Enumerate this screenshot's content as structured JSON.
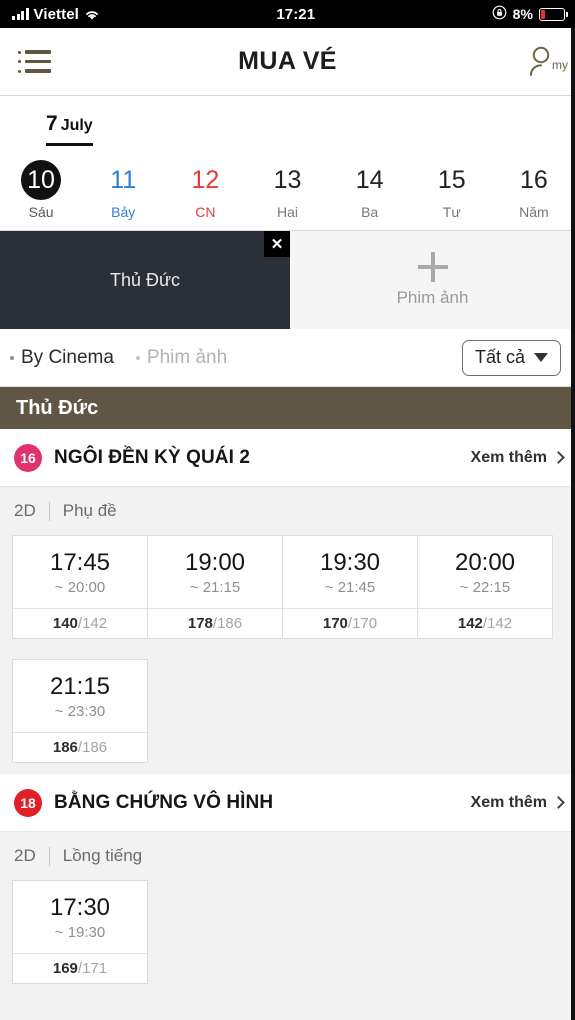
{
  "status_bar": {
    "carrier": "Viettel",
    "time": "17:21",
    "battery_percent": "8%",
    "signal_icon": "signal-bars-icon",
    "wifi_icon": "wifi-icon",
    "lock_rotation_icon": "rotation-lock-icon",
    "battery_icon": "battery-low-icon"
  },
  "nav": {
    "title": "MUA VÉ",
    "menu_icon": "hamburger-list-icon",
    "profile_icon": "profile-person-icon",
    "profile_label": "my"
  },
  "date_strip": {
    "month_number": "7",
    "month_name": "July",
    "days": [
      {
        "num": "10",
        "label": "Sáu",
        "state": "selected"
      },
      {
        "num": "11",
        "label": "Bảy",
        "state": "saturday"
      },
      {
        "num": "12",
        "label": "CN",
        "state": "sunday"
      },
      {
        "num": "13",
        "label": "Hai",
        "state": "normal"
      },
      {
        "num": "14",
        "label": "Ba",
        "state": "normal"
      },
      {
        "num": "15",
        "label": "Tư",
        "state": "normal"
      },
      {
        "num": "16",
        "label": "Năm",
        "state": "normal"
      }
    ]
  },
  "tabs": {
    "cinema_tab_label": "Thủ Đức",
    "close_icon": "close-x-icon",
    "add_tab_label": "Phim ảnh",
    "add_icon": "plus-icon"
  },
  "filter_bar": {
    "options": [
      {
        "label": "By Cinema",
        "active": true
      },
      {
        "label": "Phim ảnh",
        "active": false
      }
    ],
    "select_value": "Tất cả",
    "select_icon": "chevron-down-icon"
  },
  "cinema_section": {
    "name": "Thủ Đức"
  },
  "movies": [
    {
      "age_rating": "16",
      "age_color": "#e0336b",
      "title": "NGÔI ĐỀN KỲ QUÁI 2",
      "more_label": "Xem thêm",
      "format": "2D",
      "audio": "Phụ đề",
      "showtimes": [
        {
          "time": "17:45",
          "end": "~ 20:00",
          "seats_available": "140",
          "seats_total": "142"
        },
        {
          "time": "19:00",
          "end": "~ 21:15",
          "seats_available": "178",
          "seats_total": "186"
        },
        {
          "time": "19:30",
          "end": "~ 21:45",
          "seats_available": "170",
          "seats_total": "170"
        },
        {
          "time": "20:00",
          "end": "~ 22:15",
          "seats_available": "142",
          "seats_total": "142"
        },
        {
          "time": "21:15",
          "end": "~ 23:30",
          "seats_available": "186",
          "seats_total": "186"
        }
      ]
    },
    {
      "age_rating": "18",
      "age_color": "#e01f26",
      "title": "BẰNG CHỨNG VÔ HÌNH",
      "more_label": "Xem thêm",
      "format": "2D",
      "audio": "Lồng tiếng",
      "showtimes": [
        {
          "time": "17:30",
          "end": "~ 19:30",
          "seats_available": "169",
          "seats_total": "171"
        }
      ]
    }
  ]
}
